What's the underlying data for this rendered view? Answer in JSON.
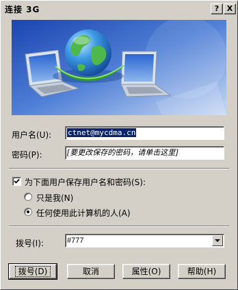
{
  "window": {
    "title": "连接 3G",
    "help_glyph": "?",
    "close_glyph": "X"
  },
  "username": {
    "label": "用户名(U):",
    "value": "ctnet@mycdma.cn"
  },
  "password": {
    "label": "密码(P):",
    "value": "[要更改保存的密码，请单击这里]"
  },
  "save": {
    "label": "为下面用户保存用户名和密码(S):",
    "checked": true,
    "options": [
      {
        "label": "只是我(N)",
        "selected": false
      },
      {
        "label": "任何使用此计算机的人(A)",
        "selected": true
      }
    ]
  },
  "dial": {
    "label": "拨号(I):",
    "value": "#777"
  },
  "buttons": {
    "dial": "拨号(D)",
    "cancel": "取消",
    "properties": "属性(O)",
    "help": "帮助(H)"
  },
  "colors": {
    "banner_top": "#1f4fb8",
    "banner_bottom": "#b8cdf0",
    "selection": "#0a246a",
    "face": "#d4d0c8"
  },
  "icons": [
    "help-icon",
    "close-icon",
    "globe-icon",
    "laptop-icon",
    "dropdown-arrow-icon"
  ]
}
